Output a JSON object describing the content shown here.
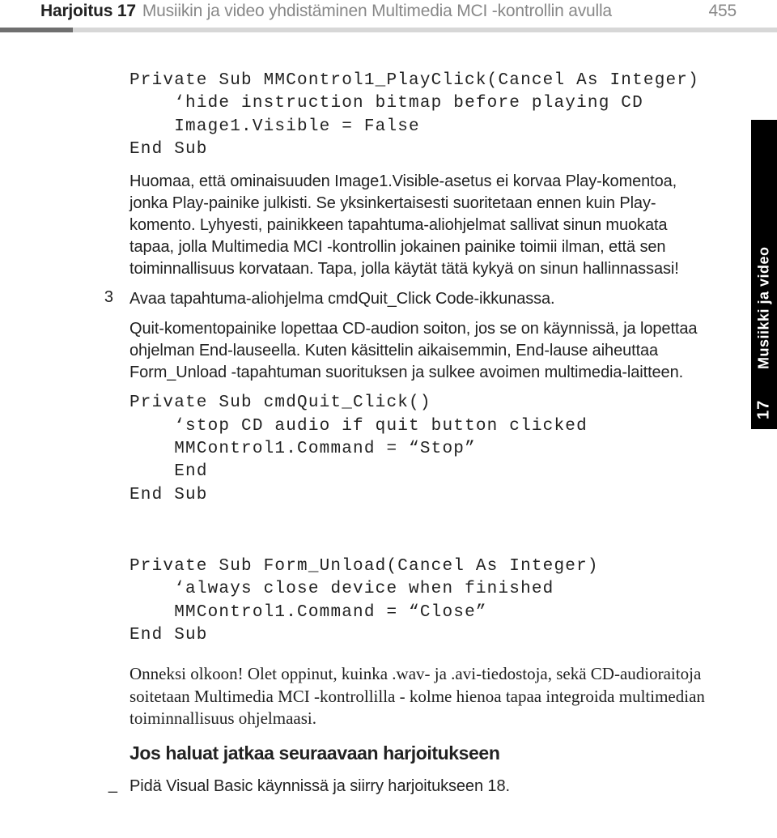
{
  "header": {
    "prefix": "Harjoitus 17",
    "title": "Musiikin ja video yhdistäminen Multimedia MCI -kontrollin avulla",
    "pagenum": "455"
  },
  "sidebar": {
    "number": "17",
    "label": "Musiikki ja video"
  },
  "code1": "Private Sub MMControl1_PlayClick(Cancel As Integer)\n    ‘hide instruction bitmap before playing CD\n    Image1.Visible = False\nEnd Sub",
  "para_note": "Huomaa, että ominaisuuden Image1.Visible-asetus ei korvaa Play-komentoa, jonka Play-painike julkisti. Se yksinkertaisesti suoritetaan ennen kuin Play-komento. Lyhyesti, painikkeen tapahtuma-aliohjelmat sallivat sinun muokata tapaa, jolla Multimedia MCI -kontrollin jokainen painike toimii ilman, että sen toiminnallisuus korvataan. Tapa, jolla käytät tätä kykyä on sinun hallinnassasi!",
  "step3_num": "3",
  "step3_text": "Avaa tapahtuma-aliohjelma cmdQuit_Click Code-ikkunassa.",
  "para_quit": "Quit-komentopainike lopettaa CD-audion soiton, jos se on käynnissä, ja lopettaa ohjelman End-lauseella. Kuten käsittelin aikaisemmin, End-lause aiheuttaa Form_Unload -tapahtuman suorituksen ja sulkee avoimen multimedia-laitteen.",
  "code2": "Private Sub cmdQuit_Click()\n    ‘stop CD audio if quit button clicked\n    MMControl1.Command = “Stop”\n    End\nEnd Sub",
  "code3": "Private Sub Form_Unload(Cancel As Integer)\n    ‘always close device when finished\n    MMControl1.Command = “Close”\nEnd Sub",
  "para_congrats": "Onneksi olkoon! Olet oppinut, kuinka .wav- ja .avi-tiedostoja, sekä CD-audioraitoja soitetaan Multimedia MCI -kontrollilla - kolme hienoa tapaa integroida multimedian toiminnallisuus ohjelmaasi.",
  "subhead": "Jos haluat jatkaa seuraavaan harjoitukseen",
  "bullet_dash": "_",
  "bullet_text": "Pidä Visual Basic käynnissä ja siirry harjoitukseen 18."
}
